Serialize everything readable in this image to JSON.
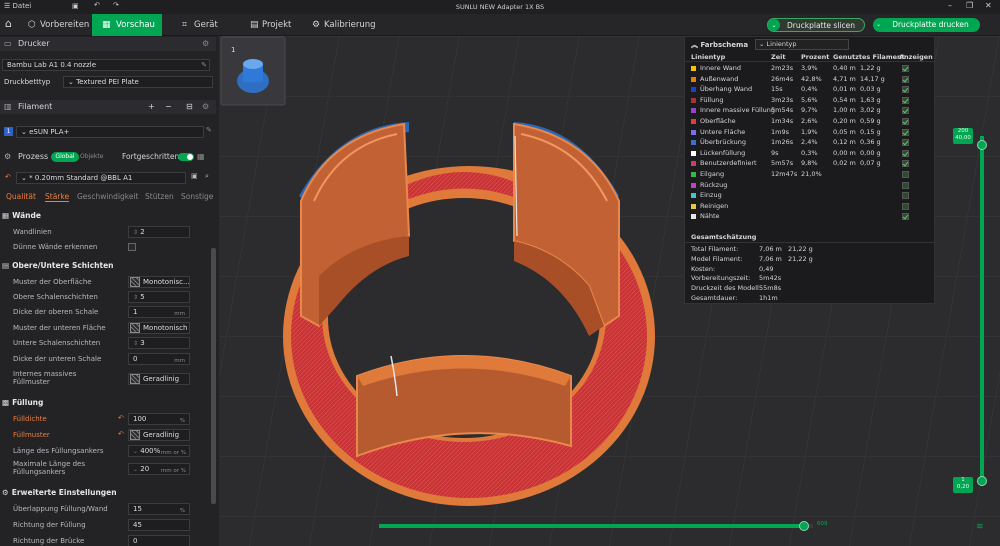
{
  "titlebar": {
    "menu": "Datei",
    "title": "SUNLU NEW Adapter 1X BS"
  },
  "tabs": [
    {
      "label": "Vorbereiten",
      "icon": "cube-icon"
    },
    {
      "label": "Vorschau",
      "icon": "preview-icon"
    },
    {
      "label": "Gerät",
      "icon": "device-icon"
    },
    {
      "label": "Projekt",
      "icon": "project-icon"
    },
    {
      "label": "Kalibrierung",
      "icon": "calibration-icon"
    }
  ],
  "actions": {
    "slice": "Druckplatte slicen",
    "print": "Druckplatte drucken"
  },
  "printer": {
    "header": "Drucker",
    "name": "Bambu Lab A1 0.4 nozzle",
    "bed_label": "Druckbetttyp",
    "bed_value": "Textured PEI Plate"
  },
  "filament": {
    "header": "Filament",
    "index": "1",
    "name": "eSUN PLA+"
  },
  "process": {
    "header": "Prozess",
    "global": "Global",
    "objects": "Objekte",
    "advanced": "Fortgeschritten",
    "preset": "* 0.20mm Standard @BBL A1"
  },
  "subtabs": [
    "Qualität",
    "Stärke",
    "Geschwindigkeit",
    "Stützen",
    "Sonstige"
  ],
  "sections": {
    "walls": {
      "title": "Wände",
      "rows": [
        {
          "label": "Wandlinien",
          "value": "2"
        },
        {
          "label": "Dünne Wände erkennen",
          "value": ""
        }
      ]
    },
    "shells": {
      "title": "Obere/Untere Schichten",
      "rows": [
        {
          "label": "Muster der Oberfläche",
          "value": "Monotonisc..."
        },
        {
          "label": "Obere Schalenschichten",
          "value": "5"
        },
        {
          "label": "Dicke der oberen Schale",
          "value": "1",
          "unit": "mm"
        },
        {
          "label": "Muster der unteren Fläche",
          "value": "Monotonisch"
        },
        {
          "label": "Untere Schalenschichten",
          "value": "3"
        },
        {
          "label": "Dicke der unteren Schale",
          "value": "0",
          "unit": "mm"
        },
        {
          "label": "Internes massives Füllmuster",
          "value": "Geradlinig"
        }
      ]
    },
    "infill": {
      "title": "Füllung",
      "rows": [
        {
          "label": "Fülldichte",
          "value": "100",
          "unit": "%"
        },
        {
          "label": "Füllmuster",
          "value": "Geradlinig"
        },
        {
          "label": "Länge des Füllungsankers",
          "value": "400%",
          "unit": "mm or %"
        },
        {
          "label": "Maximale Länge des Füllungsankers",
          "value": "20",
          "unit": "mm or %"
        }
      ]
    },
    "advanced": {
      "title": "Erweiterte Einstellungen",
      "rows": [
        {
          "label": "Überlappung Füllung/Wand",
          "value": "15",
          "unit": "%"
        },
        {
          "label": "Richtung der Füllung",
          "value": "45"
        },
        {
          "label": "Richtung der Brücke",
          "value": "0"
        }
      ]
    }
  },
  "plate": {
    "number": "1"
  },
  "legend": {
    "scheme_label": "Farbschema",
    "scheme_value": "Linientyp",
    "headers": [
      "Linientyp",
      "Zeit",
      "Prozent",
      "Genutztes Filament",
      "Anzeigen"
    ],
    "rows": [
      {
        "name": "Innere Wand",
        "time": "2m23s",
        "pct": "3,9%",
        "len": "0,40 m",
        "g": "1,22 g",
        "color": "#f5c400"
      },
      {
        "name": "Außenwand",
        "time": "26m4s",
        "pct": "42,8%",
        "len": "4,71 m",
        "g": "14,17 g",
        "color": "#f07d00"
      },
      {
        "name": "Überhang Wand",
        "time": "15s",
        "pct": "0,4%",
        "len": "0,01 m",
        "g": "0,03 g",
        "color": "#1f3fd4"
      },
      {
        "name": "Füllung",
        "time": "3m23s",
        "pct": "5,6%",
        "len": "0,54 m",
        "g": "1,63 g",
        "color": "#b03030"
      },
      {
        "name": "Innere massive Füllung",
        "time": "5m54s",
        "pct": "9,7%",
        "len": "1,00 m",
        "g": "3,02 g",
        "color": "#9b3fd0"
      },
      {
        "name": "Oberfläche",
        "time": "1m34s",
        "pct": "2,6%",
        "len": "0,20 m",
        "g": "0,59 g",
        "color": "#e83a3a"
      },
      {
        "name": "Untere Fläche",
        "time": "1m9s",
        "pct": "1,9%",
        "len": "0,05 m",
        "g": "0,15 g",
        "color": "#7a6cf0"
      },
      {
        "name": "Überbrückung",
        "time": "1m26s",
        "pct": "2,4%",
        "len": "0,12 m",
        "g": "0,36 g",
        "color": "#3c70c8"
      },
      {
        "name": "Lückenfüllung",
        "time": "9s",
        "pct": "0,3%",
        "len": "0,00 m",
        "g": "0,00 g",
        "color": "#ffffff"
      },
      {
        "name": "Benutzerdefiniert",
        "time": "5m57s",
        "pct": "9,8%",
        "len": "0,02 m",
        "g": "0,07 g",
        "color": "#d13c64"
      },
      {
        "name": "Eilgang",
        "time": "12m47s",
        "pct": "21,0%",
        "len": "",
        "g": "",
        "color": "#3ab34a"
      },
      {
        "name": "Rückzug",
        "time": "",
        "pct": "",
        "len": "",
        "g": "",
        "color": "#c83cc8"
      },
      {
        "name": "Einzug",
        "time": "",
        "pct": "",
        "len": "",
        "g": "",
        "color": "#3cc8c8"
      },
      {
        "name": "Reinigen",
        "time": "",
        "pct": "",
        "len": "",
        "g": "",
        "color": "#e6c83c"
      },
      {
        "name": "Nähte",
        "time": "",
        "pct": "",
        "len": "",
        "g": "",
        "color": "#e6e6e6"
      }
    ],
    "summary_title": "Gesamtschätzung",
    "summary": [
      {
        "k": "Total Filament:",
        "a": "7,06 m",
        "b": "21,22 g"
      },
      {
        "k": "Model Filament:",
        "a": "7,06 m",
        "b": "21,22 g"
      },
      {
        "k": "Kosten:",
        "a": "0,49",
        "b": ""
      },
      {
        "k": "Vorbereitungszeit:",
        "a": "5m42s",
        "b": ""
      },
      {
        "k": "Druckzeit des Modell:",
        "a": "55m8s",
        "b": ""
      },
      {
        "k": "Gesamtdauer:",
        "a": "1h1m",
        "b": ""
      }
    ]
  },
  "layer_slider": {
    "top_value": "200",
    "top_height": "40,00",
    "bottom_value": "1",
    "bottom_height": "0,20"
  },
  "move_slider": {
    "value": "609",
    "fraction": 0.98
  },
  "colors": {
    "accent": "#00a651",
    "model_orange": "#e07a3a",
    "base_red": "#c83236"
  }
}
